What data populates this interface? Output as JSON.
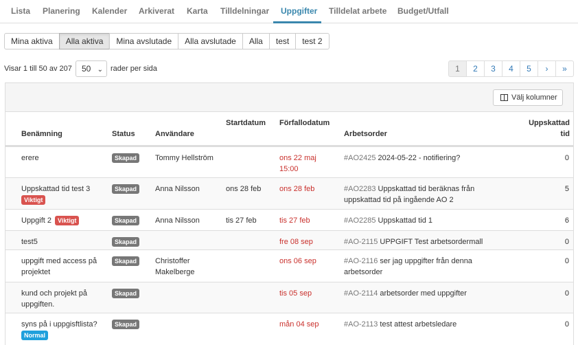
{
  "nav": {
    "tabs": [
      "Lista",
      "Planering",
      "Kalender",
      "Arkiverat",
      "Karta",
      "Tilldelningar",
      "Uppgifter",
      "Tilldelat arbete",
      "Budget/Utfall"
    ],
    "active": "Uppgifter"
  },
  "filters": [
    "Mina aktiva",
    "Alla aktiva",
    "Mina avslutade",
    "Alla avslutade",
    "Alla",
    "test",
    "test 2"
  ],
  "active_filter": "Alla aktiva",
  "info": {
    "showing": "Visar 1 till 50 av 207",
    "page_size": "50",
    "per_page_label": "rader per sida"
  },
  "pager": [
    "1",
    "2",
    "3",
    "4",
    "5",
    "›",
    "»"
  ],
  "choose_columns": "Välj kolumner",
  "columns": {
    "name": "Benämning",
    "status": "Status",
    "user": "Användare",
    "start": "Startdatum",
    "due": "Förfallodatum",
    "order": "Arbetsorder",
    "est1": "Uppskattad",
    "est2": "tid"
  },
  "rows": [
    {
      "name": [
        "erere"
      ],
      "priority": "",
      "status": "Skapad",
      "user": [
        "Tommy Hellström"
      ],
      "start": "",
      "due": [
        "ons 22 maj",
        "15:00"
      ],
      "ao_id": "#AO2425",
      "ao_text": [
        "2024-05-22 - notifiering?"
      ],
      "est": "0"
    },
    {
      "name": [
        "Uppskattad tid test 3"
      ],
      "priority": "Viktigt",
      "status": "Skapad",
      "user": [
        "Anna Nilsson"
      ],
      "start": "ons 28 feb",
      "due": [
        "ons 28 feb"
      ],
      "ao_id": "#AO2283",
      "ao_text": [
        "Uppskattad tid beräknas från",
        "uppskattad tid på ingående AO 2"
      ],
      "est": "5"
    },
    {
      "name": [
        "Uppgift 2"
      ],
      "priority": "Viktigt",
      "status": "Skapad",
      "user": [
        "Anna Nilsson"
      ],
      "start": "tis 27 feb",
      "due": [
        "tis 27 feb"
      ],
      "ao_id": "#AO2285",
      "ao_text": [
        "Uppskattad tid 1"
      ],
      "est": "6"
    },
    {
      "name": [
        "test5"
      ],
      "priority": "",
      "status": "Skapad",
      "user": [
        ""
      ],
      "start": "",
      "due": [
        "fre 08 sep"
      ],
      "ao_id": "#AO-2115",
      "ao_text": [
        "UPPGIFT Test arbetsordermall"
      ],
      "est": "0"
    },
    {
      "name": [
        "uppgift med access på",
        "projektet"
      ],
      "priority": "",
      "status": "Skapad",
      "user": [
        "Christoffer",
        "Makelberge"
      ],
      "start": "",
      "due": [
        "ons 06 sep"
      ],
      "ao_id": "#AO-2116",
      "ao_text": [
        "ser jag uppgifter från denna",
        "arbetsorder"
      ],
      "est": "0"
    },
    {
      "name": [
        "kund och projekt på",
        "uppgiften."
      ],
      "priority": "",
      "status": "Skapad",
      "user": [
        ""
      ],
      "start": "",
      "due": [
        "tis 05 sep"
      ],
      "ao_id": "#AO-2114",
      "ao_text": [
        "arbetsorder med uppgifter"
      ],
      "est": "0"
    },
    {
      "name": [
        "syns på i uppgisftlista?"
      ],
      "priority": "Normal",
      "status": "Skapad",
      "user": [
        ""
      ],
      "start": "",
      "due": [
        "mån 04 sep"
      ],
      "ao_id": "#AO-2113",
      "ao_text": [
        "test attest arbetsledare"
      ],
      "est": "0"
    }
  ],
  "colors": {
    "accent": "#3a87ad",
    "due_red": "#c9302c",
    "badge_gray": "#777777",
    "badge_red": "#d9534f",
    "badge_blue": "#1fa0dc"
  }
}
